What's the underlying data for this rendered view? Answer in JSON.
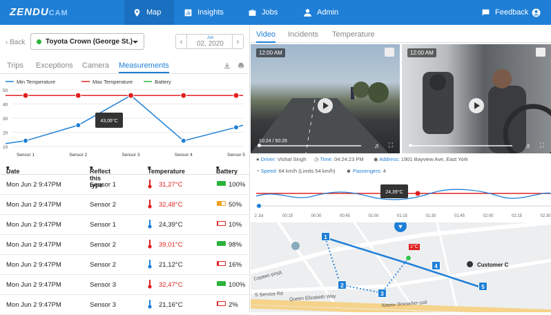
{
  "header": {
    "logo_main": "ZENDU",
    "logo_sub": "CAM",
    "nav": [
      {
        "label": "Map",
        "icon": "location-pin-icon",
        "active": true
      },
      {
        "label": "Insights",
        "icon": "bar-chart-icon",
        "active": false
      },
      {
        "label": "Jobs",
        "icon": "briefcase-icon",
        "active": false
      },
      {
        "label": "Admin",
        "icon": "user-icon",
        "active": false
      }
    ],
    "feedback": "Feedback",
    "account_icon": "account-circle-icon"
  },
  "left": {
    "back": "Back",
    "vehicle": "Toyota Crown (George St.)",
    "vehicle_status_color": "#2ab33a",
    "date_month": "Jun",
    "date_value": "02, 2020",
    "tabs": [
      "Trips",
      "Exceptions",
      "Camera",
      "Measurements"
    ],
    "active_tab": "Measurements",
    "download_icon": "download-icon",
    "print_icon": "print-icon"
  },
  "chart_data": {
    "type": "line",
    "categories": [
      "Sensor 1",
      "Sensor 2",
      "Sensor 3",
      "Sensor 4",
      "Sensor 5"
    ],
    "series": [
      {
        "name": "Min Temperature",
        "color": "#1f7fd6",
        "values": [
          14,
          25,
          46,
          14,
          23.5
        ]
      },
      {
        "name": "Max Temperature",
        "color": "#e02020",
        "values": [
          46,
          46,
          46,
          46,
          46
        ]
      },
      {
        "name": "Battery",
        "color": "#2ab33a",
        "values": []
      }
    ],
    "ylim": [
      10,
      50
    ],
    "yticks": [
      "10",
      "20",
      "30",
      "40",
      "50"
    ],
    "tooltip": "43,06°C",
    "legend": "top",
    "grid": true
  },
  "table": {
    "headers": [
      "Date",
      "Reflect this type",
      "Temperature",
      "Battery"
    ],
    "rows": [
      {
        "date": "Mon Jun 2 9:47PM",
        "sensor": "Sensor 1",
        "temp": "31,27°C",
        "hot": true,
        "battery": "100%",
        "level": 1.0,
        "bcolor": "#2ab33a"
      },
      {
        "date": "Mon Jun 2 9:47PM",
        "sensor": "Sensor 2",
        "temp": "32,48°C",
        "hot": true,
        "battery": "50%",
        "level": 0.5,
        "bcolor": "#f0a020"
      },
      {
        "date": "Mon Jun 2 9:47PM",
        "sensor": "Sensor 1",
        "temp": "24,39°C",
        "hot": false,
        "battery": "10%",
        "level": 0.1,
        "bcolor": "#e02020"
      },
      {
        "date": "Mon Jun 2 9:47PM",
        "sensor": "Sensor 2",
        "temp": "39,01°C",
        "hot": true,
        "battery": "98%",
        "level": 0.98,
        "bcolor": "#2ab33a"
      },
      {
        "date": "Mon Jun 2 9:47PM",
        "sensor": "Sensor 2",
        "temp": "21,12°C",
        "hot": false,
        "battery": "16%",
        "level": 0.16,
        "bcolor": "#e02020"
      },
      {
        "date": "Mon Jun 2 9:47PM",
        "sensor": "Sensor 3",
        "temp": "32,47°C",
        "hot": true,
        "battery": "100%",
        "level": 1.0,
        "bcolor": "#2ab33a"
      },
      {
        "date": "Mon Jun 2 9:47PM",
        "sensor": "Sensor 3",
        "temp": "21,16°C",
        "hot": false,
        "battery": "2%",
        "level": 0.02,
        "bcolor": "#e02020"
      }
    ]
  },
  "right": {
    "tabs": [
      "Video",
      "Incidents",
      "Temperature"
    ],
    "active_tab": "Video",
    "video1": {
      "time": "12:00 AM",
      "duration": "10:24 / 50:26"
    },
    "video2": {
      "time": "12:00 AM"
    },
    "info": {
      "driver_label": "Driver:",
      "driver": "Vishal Singh",
      "time_label": "Time:",
      "time": "04:24:23 PM",
      "address_label": "Address:",
      "address": "1901 Bayview Ave, East York",
      "speed_label": "Speed:",
      "speed": "64 km/h (Limits 54 km/h)",
      "passengers_label": "Passengers:",
      "passengers": "4"
    },
    "timeline": {
      "tooltip": "24,39°C",
      "ticks": [
        "2 Jul",
        "00:15",
        "00:30",
        "00:45",
        "01:00",
        "01:15",
        "01:30",
        "01:45",
        "02:00",
        "02:15",
        "02:30"
      ]
    },
    "map": {
      "markers": [
        "1",
        "2",
        "3",
        "4",
        "5"
      ],
      "customer": "Customer C",
      "temp_flag": "1°C",
      "roads": [
        "Queen Elizabeth Way",
        "S Service Rd",
        "Кевин-Элизабет-уэй",
        "Сервис-роуд"
      ]
    }
  }
}
